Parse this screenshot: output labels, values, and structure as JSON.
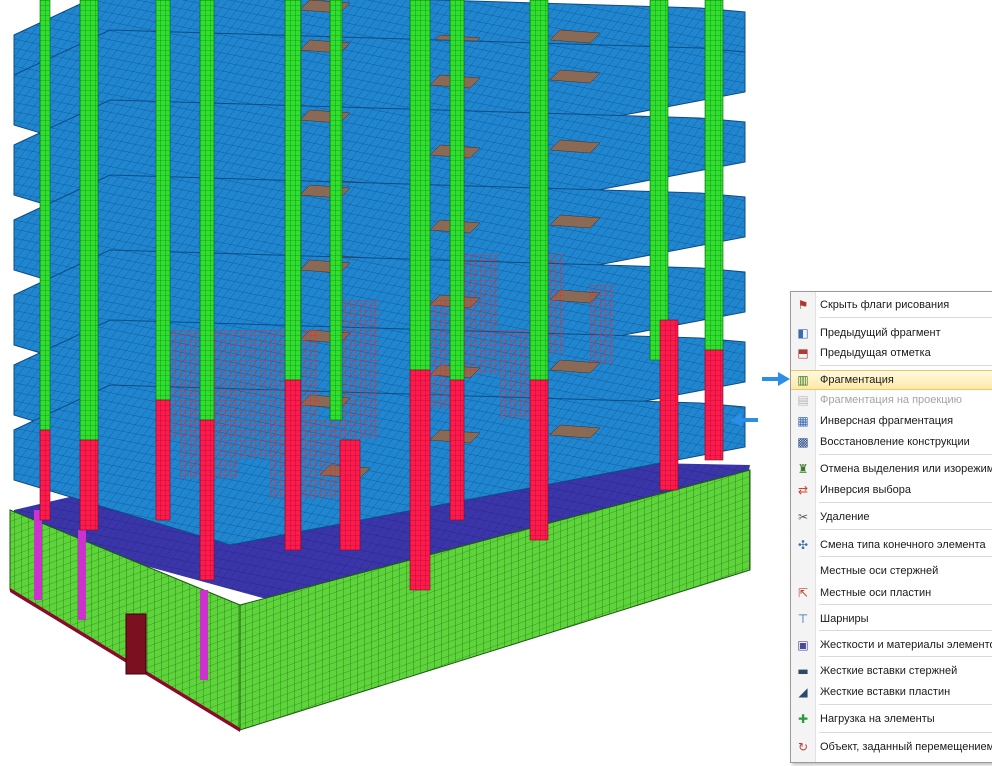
{
  "viewport": {
    "description_icon": "fem-model-3d",
    "colors": {
      "slab": "#1f86cf",
      "slab_mesh": "#0d4c86",
      "column": "#2fe02f",
      "selected_element": "#ff1a4d",
      "fragment_mesh": "#ff2020",
      "opening": "#8a6a55",
      "foundation": "#3a35a8",
      "base_wall": "#5cd43a",
      "column_magenta": "#cc33cc"
    }
  },
  "arrows": {
    "right_arrow_color": "#2b8ee8",
    "left_arrow_color": "#2b8ee8"
  },
  "menu": {
    "items": [
      {
        "label": "Скрыть флаги рисования",
        "icon": "hide-flags-icon",
        "disabled": false,
        "highlight": false
      },
      {
        "label": "Предыдущий фрагмент",
        "icon": "previous-fragment-icon",
        "disabled": false,
        "highlight": false
      },
      {
        "label": "Предыдущая отметка",
        "icon": "previous-mark-icon",
        "disabled": false,
        "highlight": false
      },
      {
        "label": "Фрагментация",
        "icon": "fragmentation-icon",
        "disabled": false,
        "highlight": true
      },
      {
        "label": "Фрагментация на проекцию",
        "icon": "fragmentation-projection-icon",
        "disabled": true,
        "highlight": false
      },
      {
        "label": "Инверсная фрагментация",
        "icon": "inverse-fragmentation-icon",
        "disabled": false,
        "highlight": false
      },
      {
        "label": "Восстановление конструкции",
        "icon": "restore-construction-icon",
        "disabled": false,
        "highlight": false
      },
      {
        "label": "Отмена выделения или изорежима",
        "icon": "cancel-selection-icon",
        "disabled": false,
        "highlight": false
      },
      {
        "label": "Инверсия выбора",
        "icon": "invert-selection-icon",
        "disabled": false,
        "highlight": false
      },
      {
        "label": "Удаление",
        "icon": "delete-scissors-icon",
        "disabled": false,
        "highlight": false
      },
      {
        "label": "Смена типа конечного элемента",
        "icon": "change-element-type-icon",
        "disabled": false,
        "highlight": false
      },
      {
        "label": "Местные оси стержней",
        "icon": "",
        "disabled": false,
        "highlight": false
      },
      {
        "label": "Местные оси пластин",
        "icon": "plate-local-axes-icon",
        "disabled": false,
        "highlight": false
      },
      {
        "label": "Шарниры",
        "icon": "hinges-icon",
        "disabled": false,
        "highlight": false
      },
      {
        "label": "Жесткости и материалы элементов",
        "icon": "stiffness-materials-icon",
        "disabled": false,
        "highlight": false
      },
      {
        "label": "Жесткие вставки стержней",
        "icon": "rigid-inserts-bars-icon",
        "disabled": false,
        "highlight": false
      },
      {
        "label": "Жесткие вставки пластин",
        "icon": "rigid-inserts-plates-icon",
        "disabled": false,
        "highlight": false
      },
      {
        "label": "Нагрузка на элементы",
        "icon": "element-load-icon",
        "disabled": false,
        "highlight": false
      },
      {
        "label": "Объект, заданный перемещением",
        "icon": "object-by-displacement-icon",
        "disabled": false,
        "highlight": false
      }
    ]
  }
}
